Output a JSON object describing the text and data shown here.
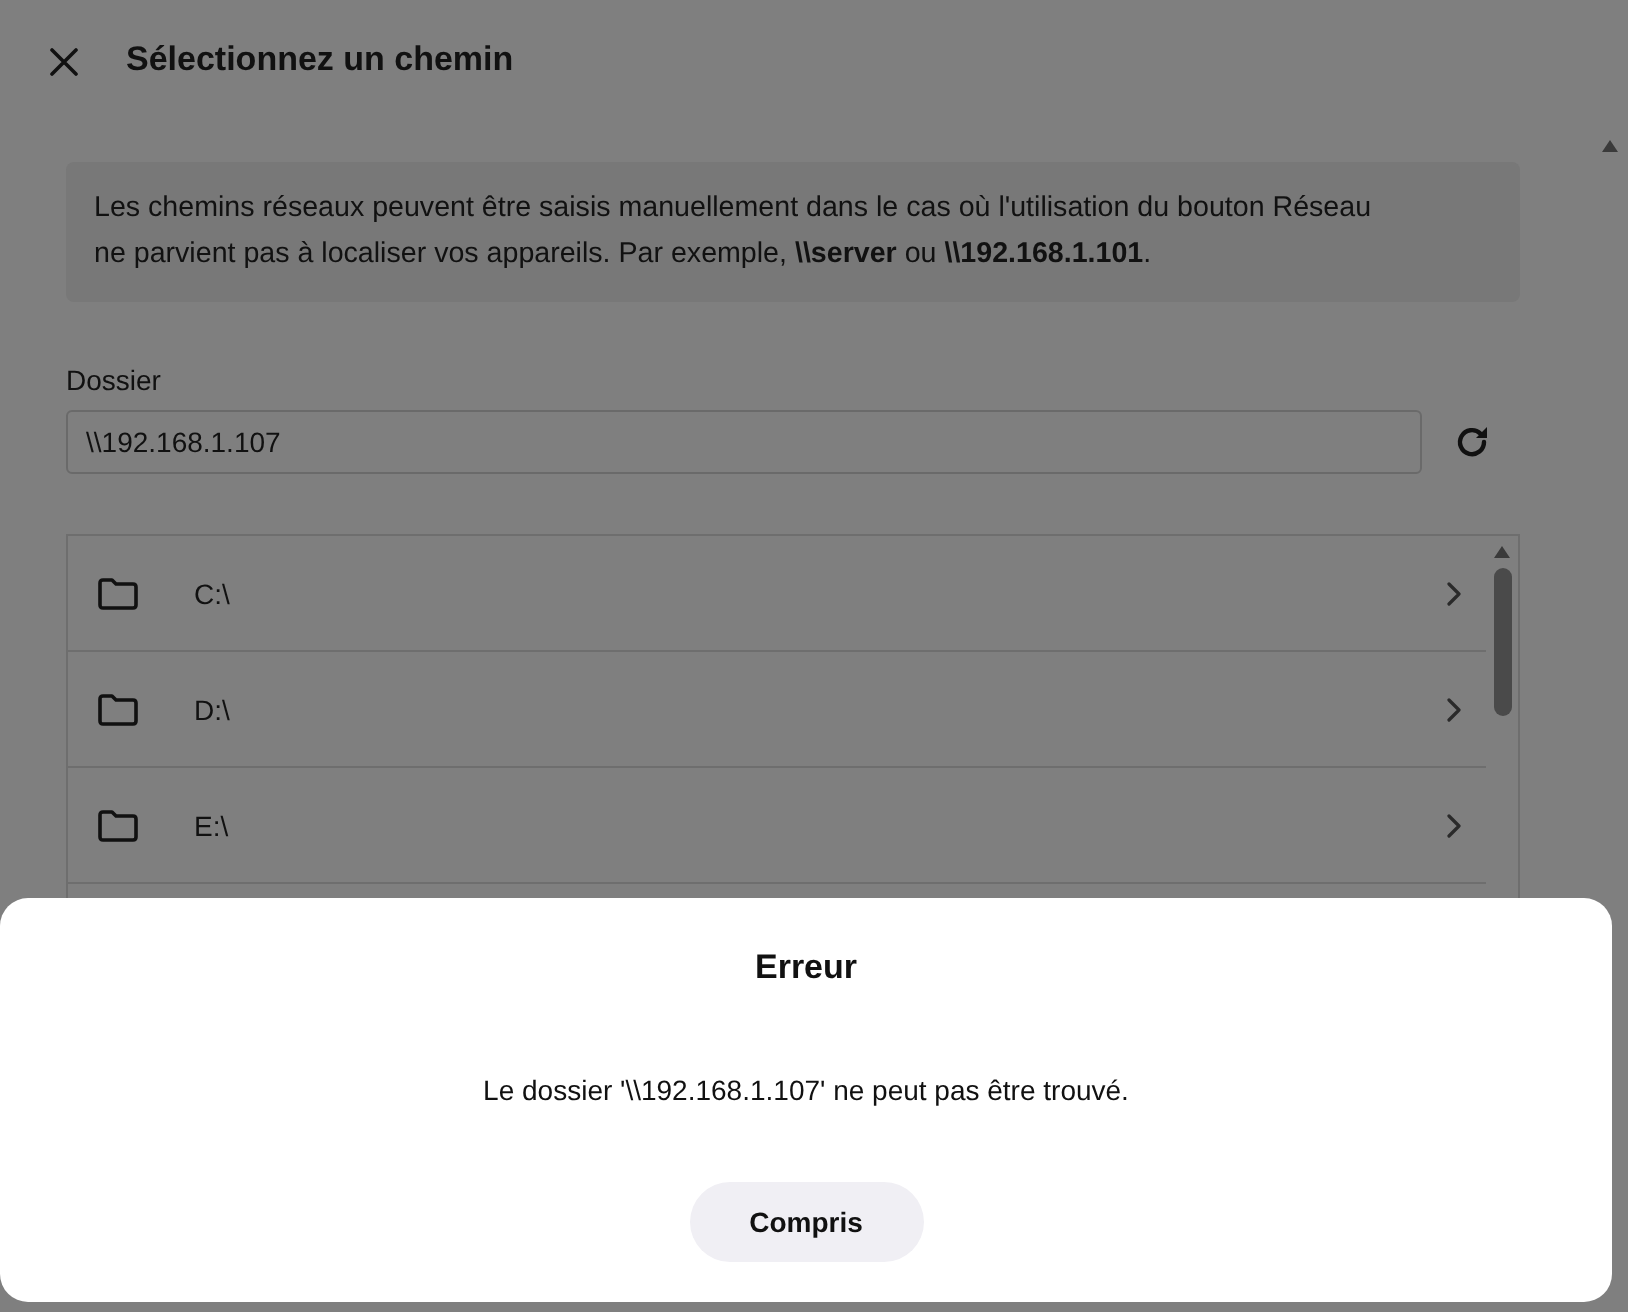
{
  "window": {
    "title": "Sélectionnez un chemin"
  },
  "info": {
    "text": "Les chemins réseaux peuvent être saisis manuellement dans le cas où l'utilisation du bouton Réseau ne parvient pas à localiser vos appareils. Par exemple, **\\\\server** ou **\\\\192.168.1.101**."
  },
  "folder_field": {
    "label": "Dossier",
    "value": "\\\\192.168.1.107"
  },
  "folders": [
    {
      "name": "C:\\"
    },
    {
      "name": "D:\\"
    },
    {
      "name": "E:\\"
    }
  ],
  "dialog": {
    "title": "Erreur",
    "message": "Le dossier '\\\\192.168.1.107' ne peut pas être trouvé.",
    "button": "Compris"
  }
}
